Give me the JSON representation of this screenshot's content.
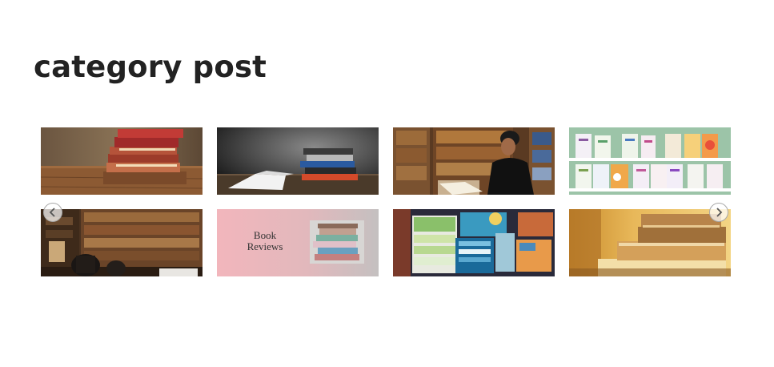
{
  "section": {
    "title": "category post"
  },
  "carousel": {
    "prev_icon": "chevron-left-icon",
    "next_icon": "chevron-right-icon",
    "items": [
      {
        "subject": "stacked old books on wooden table"
      },
      {
        "subject": "open book with stacked books on dark wooden table"
      },
      {
        "subject": "woman reading in library"
      },
      {
        "subject": "books on display shelves"
      },
      {
        "subject": "library room with armchairs and bookshelves"
      },
      {
        "subject": "book reviews banner",
        "line1": "Book",
        "line2": "Reviews"
      },
      {
        "subject": "piles of magazines and notebooks"
      },
      {
        "subject": "warm blurred stack of books"
      }
    ]
  }
}
